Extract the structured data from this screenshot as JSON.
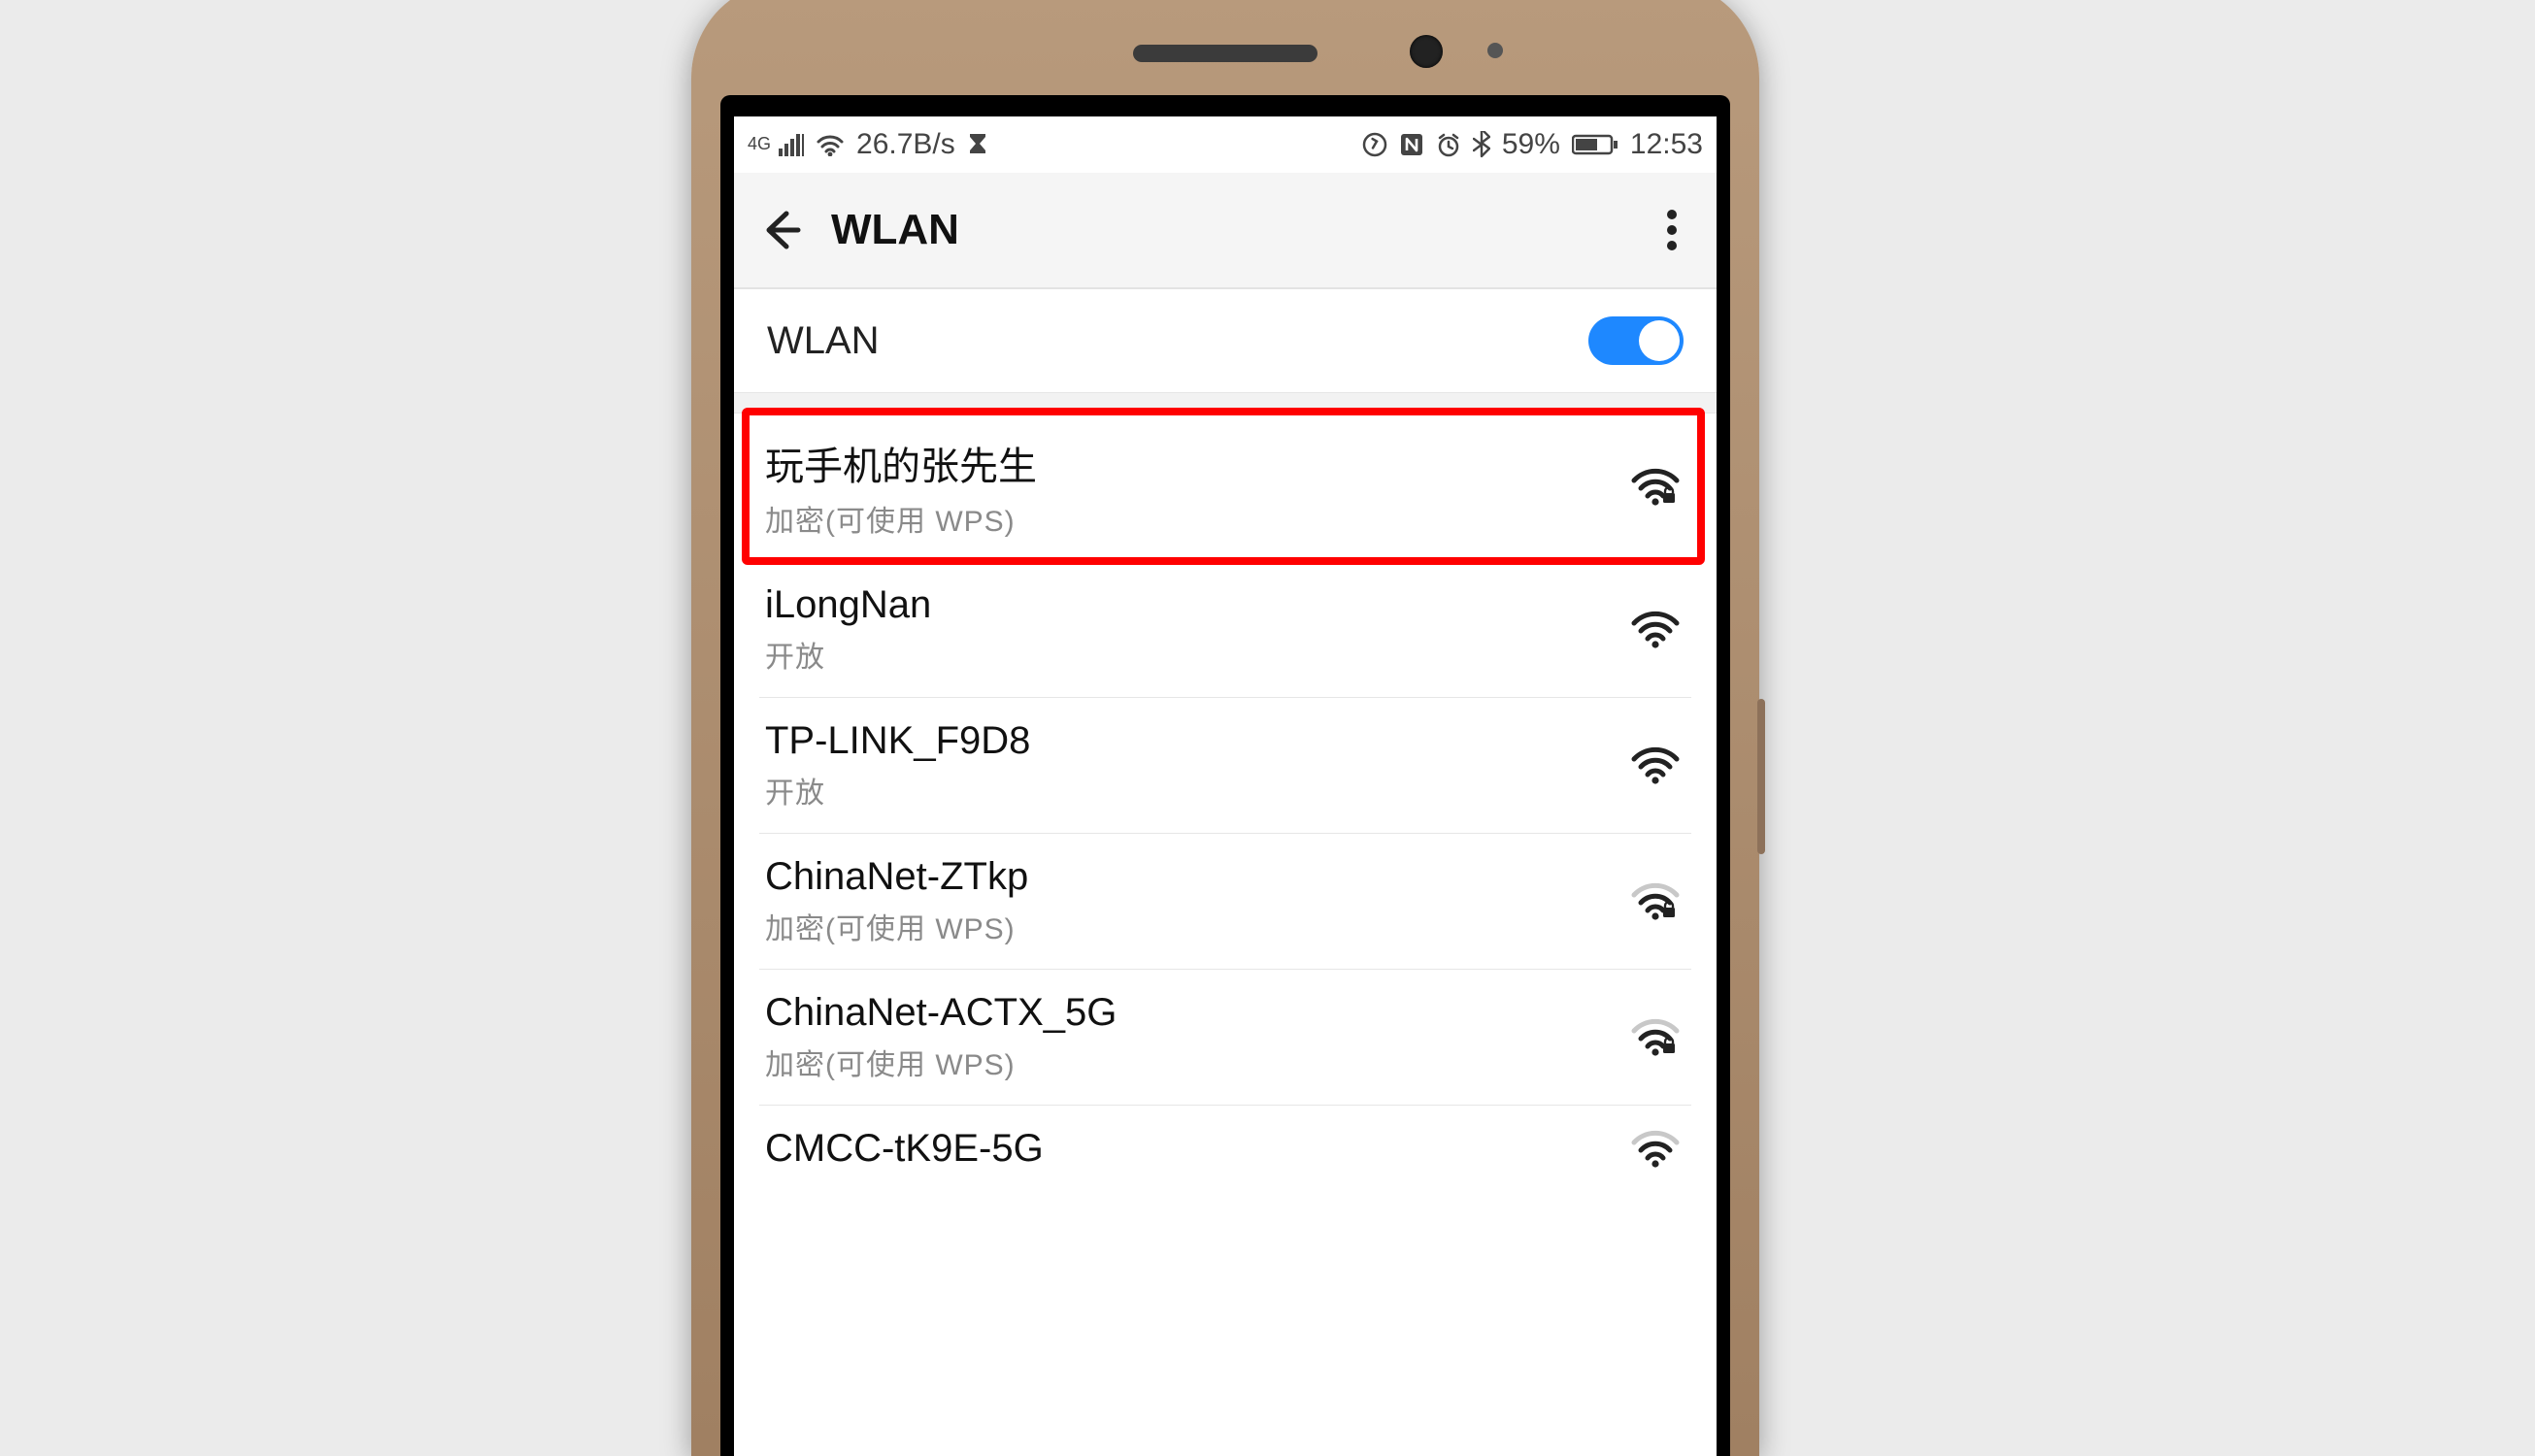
{
  "status": {
    "network_type": "4G",
    "speed": "26.7B/s",
    "battery_pct": "59%",
    "time": "12:53"
  },
  "appbar": {
    "title": "WLAN"
  },
  "toggle": {
    "label": "WLAN",
    "on": true
  },
  "networks": [
    {
      "name": "玩手机的张先生",
      "sub": "加密(可使用 WPS)",
      "locked": true,
      "strength": 3,
      "highlighted": true
    },
    {
      "name": "iLongNan",
      "sub": "开放",
      "locked": false,
      "strength": 3
    },
    {
      "name": "TP-LINK_F9D8",
      "sub": "开放",
      "locked": false,
      "strength": 3
    },
    {
      "name": "ChinaNet-ZTkp",
      "sub": "加密(可使用 WPS)",
      "locked": true,
      "strength": 2
    },
    {
      "name": "ChinaNet-ACTX_5G",
      "sub": "加密(可使用 WPS)",
      "locked": true,
      "strength": 2
    },
    {
      "name": "CMCC-tK9E-5G",
      "sub": "",
      "locked": false,
      "strength": 2,
      "partial": true
    }
  ]
}
